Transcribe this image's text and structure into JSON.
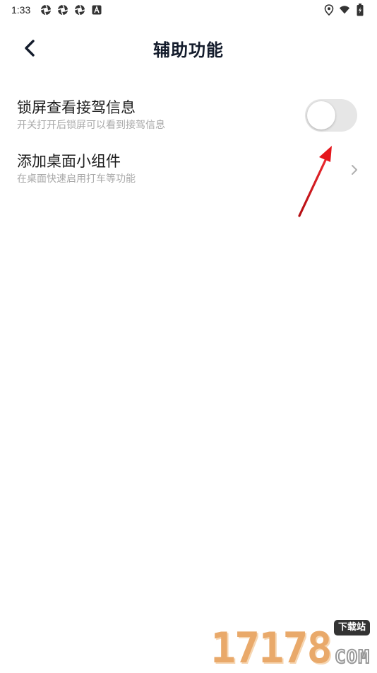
{
  "status_bar": {
    "time": "1:33",
    "left_icons": [
      "aperture-icon",
      "aperture-icon",
      "aperture-icon",
      "a-box-icon"
    ],
    "right_icons": [
      "location-icon",
      "wifi-icon",
      "battery-icon"
    ]
  },
  "header": {
    "title": "辅助功能",
    "back_icon": "chevron-left-icon"
  },
  "settings": [
    {
      "title": "锁屏查看接驾信息",
      "description": "开关打开后锁屏可以看到接驾信息",
      "control": "toggle",
      "enabled": false
    },
    {
      "title": "添加桌面小组件",
      "description": "在桌面快速启用打车等功能",
      "control": "chevron-right-icon"
    }
  ],
  "annotation": {
    "type": "arrow",
    "color": "#d9141a",
    "target": "toggle"
  },
  "watermark": {
    "digits": "17178",
    "badge": "下载站",
    "suffix": "COM"
  },
  "colors": {
    "title_text": "#141c2c",
    "desc_text": "#a8a8a8",
    "toggle_off_bg": "#e6e6e6",
    "arrow_red": "#d9141a",
    "watermark_orange": "#e9a96a"
  }
}
